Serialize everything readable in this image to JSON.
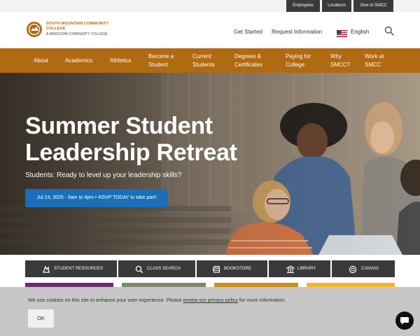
{
  "utility_bar": {
    "links": [
      "Employees",
      "Locations",
      "Give to SMCC"
    ]
  },
  "header": {
    "logo_name": "SOUTH MOUNTAIN COMMUNITY COLLEGE",
    "logo_sub": "A MARICOPA COMMUNITY COLLEGE",
    "get_started": "Get Started",
    "request_info": "Request Information",
    "language": "English"
  },
  "nav": {
    "items": [
      {
        "line1": "About",
        "line2": ""
      },
      {
        "line1": "Academics",
        "line2": ""
      },
      {
        "line1": "Athletics",
        "line2": ""
      },
      {
        "line1": "Become a",
        "line2": "Student"
      },
      {
        "line1": "Current",
        "line2": "Students"
      },
      {
        "line1": "Degrees &",
        "line2": "Certificates"
      },
      {
        "line1": "Paying for",
        "line2": "College"
      },
      {
        "line1": "Why",
        "line2": "SMCC?"
      },
      {
        "line1": "Work at",
        "line2": "SMCC"
      }
    ]
  },
  "hero": {
    "title": "Summer Student Leadership Retreat",
    "subtitle": "Students: Ready to level up your leadership skills?",
    "cta": "Jul 24, 2025 - 9am to 4pm • RSVP TODAY to take part!"
  },
  "quick_links": [
    {
      "label": "Student Resources",
      "icon": "student-resources-icon"
    },
    {
      "label": "Class Search",
      "icon": "search-icon"
    },
    {
      "label": "Bookstore",
      "icon": "books-icon"
    },
    {
      "label": "Library",
      "icon": "library-icon"
    },
    {
      "label": "Canvas",
      "icon": "canvas-icon"
    }
  ],
  "cookie": {
    "text_before": "We use cookies on this site to enhance your user experience. Please ",
    "link": "review our privacy policy",
    "text_after": " for more information.",
    "ok": "OK"
  },
  "colors": {
    "brand": "#b06a12",
    "dark": "#3a3a3a",
    "cta": "#1a6fb8"
  }
}
